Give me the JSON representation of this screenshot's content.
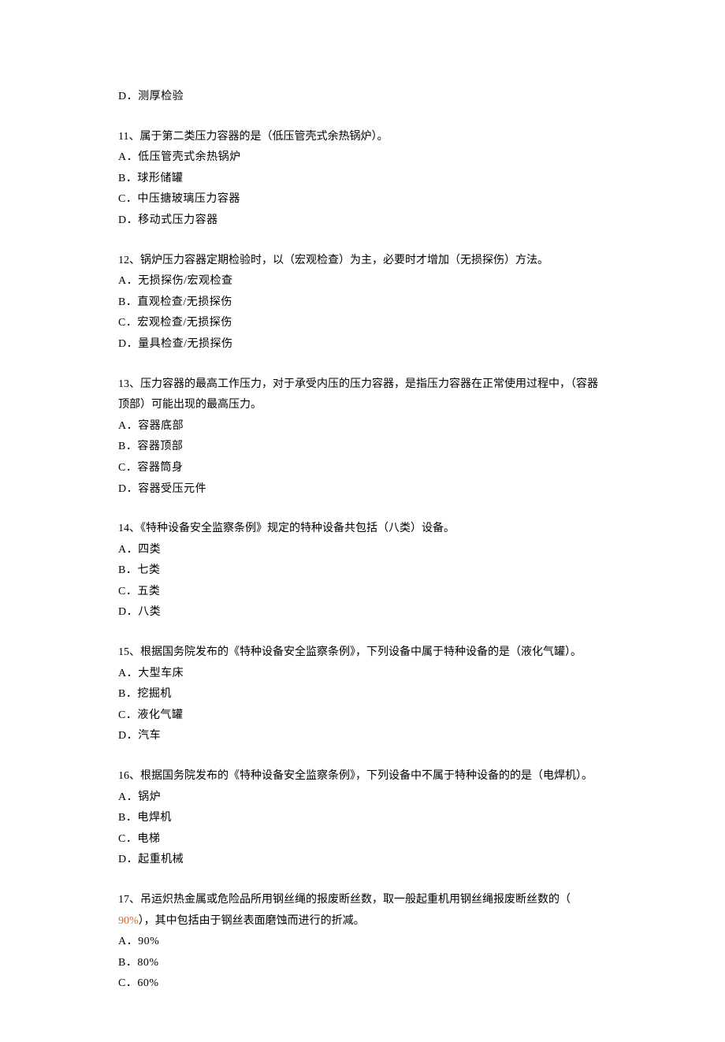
{
  "orphan": {
    "label": "D．",
    "text": "测厚检验"
  },
  "questions": [
    {
      "num": "11、",
      "stem": "属于第二类压力容器的是（低压管壳式余热锅炉）。",
      "opts": [
        {
          "label": "A．",
          "text": "低压管壳式余热锅炉"
        },
        {
          "label": "B．",
          "text": "球形储罐"
        },
        {
          "label": "C．",
          "text": "中压搪玻璃压力容器"
        },
        {
          "label": "D．",
          "text": "移动式压力容器"
        }
      ]
    },
    {
      "num": "12、",
      "stem": "锅炉压力容器定期检验时，以（宏观检查）为主，必要时才增加（无损探伤）方法。",
      "opts": [
        {
          "label": "A．",
          "text": "无损探伤/宏观检查"
        },
        {
          "label": "B．",
          "text": "直观检查/无损探伤"
        },
        {
          "label": "C．",
          "text": "宏观检查/无损探伤"
        },
        {
          "label": "D．",
          "text": "量具检查/无损探伤"
        }
      ]
    },
    {
      "num": "13、",
      "stem": "压力容器的最高工作压力，对于承受内压的压力容器，是指压力容器在正常使用过程中，（容器顶部）可能出现的最高压力。",
      "opts": [
        {
          "label": "A．",
          "text": "容器底部"
        },
        {
          "label": "B．",
          "text": "容器顶部"
        },
        {
          "label": "C．",
          "text": "容器筒身"
        },
        {
          "label": "D．",
          "text": "容器受压元件"
        }
      ]
    },
    {
      "num": "14、",
      "stem": "《特种设备安全监察条例》规定的特种设备共包括（八类）设备。",
      "opts": [
        {
          "label": "A．",
          "text": "四类"
        },
        {
          "label": "B．",
          "text": "七类"
        },
        {
          "label": "C．",
          "text": "五类"
        },
        {
          "label": "D．",
          "text": "八类"
        }
      ]
    },
    {
      "num": "15、",
      "stem": "根据国务院发布的《特种设备安全监察条例》，下列设备中属于特种设备的是（液化气罐）。",
      "opts": [
        {
          "label": "A．",
          "text": "大型车床"
        },
        {
          "label": "B．",
          "text": "挖掘机"
        },
        {
          "label": "C．",
          "text": "液化气罐"
        },
        {
          "label": "D．",
          "text": "汽车"
        }
      ]
    },
    {
      "num": "16、",
      "stem": "根据国务院发布的《特种设备安全监察条例》，下列设备中不属于特种设备的的是（电焊机）。",
      "opts": [
        {
          "label": "A．",
          "text": "锅炉"
        },
        {
          "label": "B．",
          "text": "电焊机"
        },
        {
          "label": "C．",
          "text": "电梯"
        },
        {
          "label": "D．",
          "text": "起重机械"
        }
      ]
    },
    {
      "num": "17、",
      "stem_pre": "吊运炽热金属或危险品所用钢丝绳的报废断丝数，取一般起重机用钢丝绳报废断丝数的（",
      "stem_hl": " 90%",
      "stem_post": "），其中包括由于钢丝表面磨蚀而进行的折减。",
      "opts": [
        {
          "label": "A．",
          "text": "90%"
        },
        {
          "label": "B．",
          "text": "80%"
        },
        {
          "label": "C．",
          "text": "60%"
        }
      ]
    }
  ]
}
